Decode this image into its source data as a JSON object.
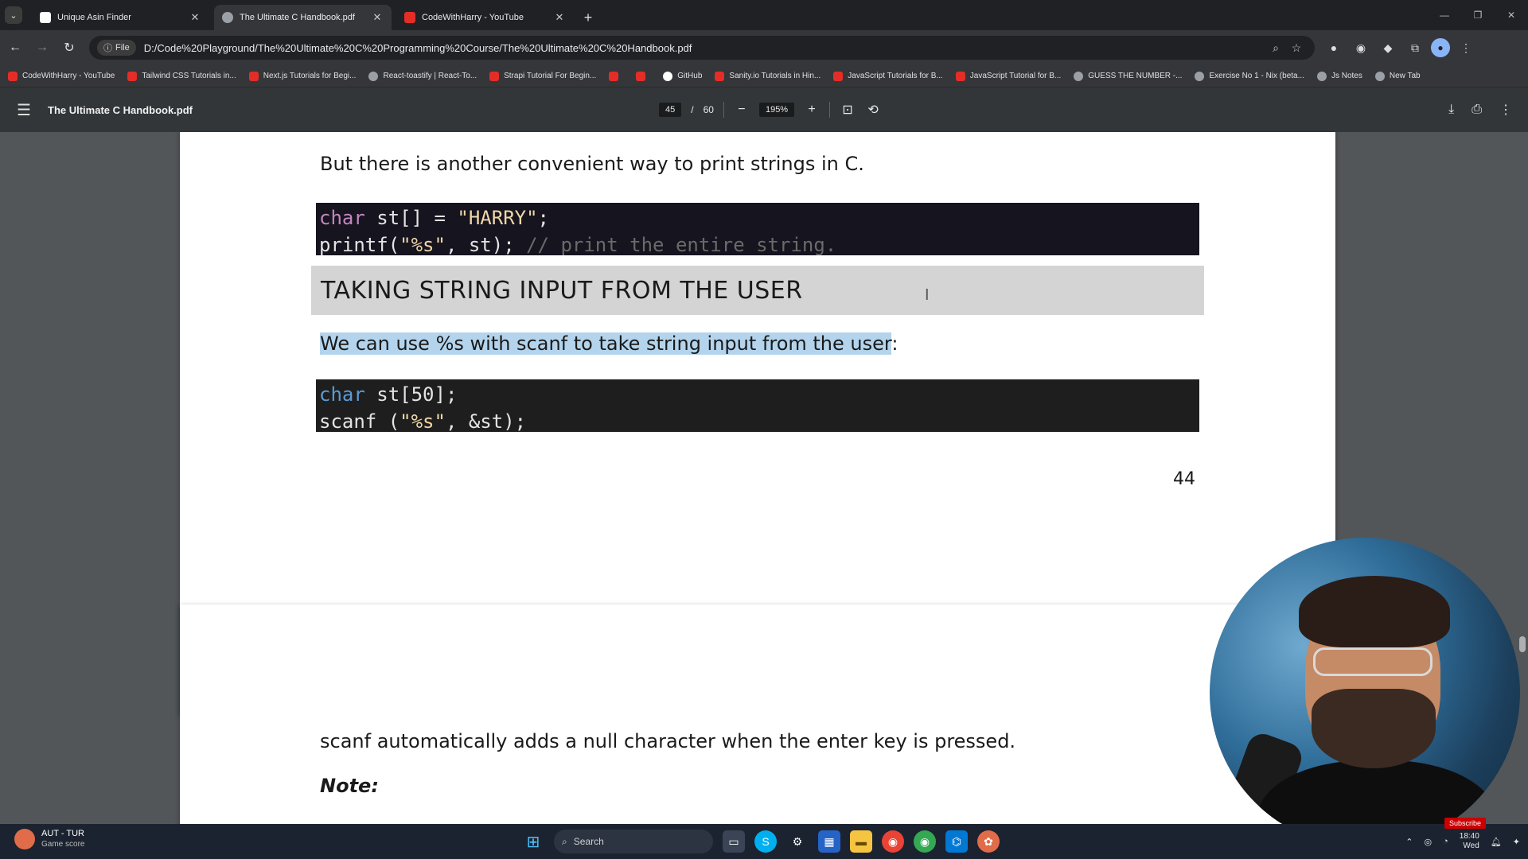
{
  "browser": {
    "tabs": [
      {
        "title": "Unique Asin Finder",
        "active": false,
        "favicon_color": "#ffffff"
      },
      {
        "title": "The Ultimate C Handbook.pdf",
        "active": true,
        "favicon_color": "#9aa0a6"
      },
      {
        "title": "CodeWithHarry - YouTube",
        "active": false,
        "favicon_color": "#e52d27"
      }
    ],
    "new_tab_label": "+",
    "address": {
      "chip_label": "File",
      "url": "D:/Code%20Playground/The%20Ultimate%20C%20Programming%20Course/The%20Ultimate%20C%20Handbook.pdf"
    },
    "bookmarks": [
      {
        "label": "CodeWithHarry - YouTube",
        "icon": "yt"
      },
      {
        "label": "Tailwind CSS Tutorials in...",
        "icon": "yt"
      },
      {
        "label": "Next.js Tutorials for Begi...",
        "icon": "yt"
      },
      {
        "label": "React-toastify | React-To...",
        "icon": "globe"
      },
      {
        "label": "Strapi Tutorial For Begin...",
        "icon": "yt"
      },
      {
        "label": "",
        "icon": "yt"
      },
      {
        "label": "",
        "icon": "yt"
      },
      {
        "label": "GitHub",
        "icon": "gh"
      },
      {
        "label": "Sanity.io Tutorials in Hin...",
        "icon": "yt"
      },
      {
        "label": "JavaScript Tutorials for B...",
        "icon": "yt"
      },
      {
        "label": "JavaScript Tutorial for B...",
        "icon": "yt"
      },
      {
        "label": "GUESS THE NUMBER -...",
        "icon": "globe"
      },
      {
        "label": "Exercise No 1 - Nix (beta...",
        "icon": "globe"
      },
      {
        "label": "Js Notes",
        "icon": "globe"
      },
      {
        "label": "New Tab",
        "icon": "globe"
      }
    ]
  },
  "pdf_viewer": {
    "doc_title": "The Ultimate C Handbook.pdf",
    "current_page": "45",
    "page_separator": "/",
    "total_pages": "60",
    "zoom": "195%",
    "zoom_out": "−",
    "zoom_in": "+"
  },
  "page44": {
    "intro": "But there is another convenient way to print strings in C.",
    "code1": {
      "line1": {
        "kw": "char",
        "rest": " st[] = ",
        "str": "\"HARRY\"",
        "end": ";"
      },
      "line2": {
        "fn": "printf(",
        "str": "\"%s\"",
        "rest": ", st); ",
        "comment": "// print the entire string."
      }
    },
    "heading": "TAKING STRING INPUT FROM THE USER",
    "para_part1": "We can use %s with scanf ",
    "para_part2": "to take string input from the user",
    "para_end": ":",
    "code2": {
      "line1": {
        "kw": "char",
        "rest": " st[50];"
      },
      "line2": {
        "fn": "scanf (",
        "str": "\"%s\"",
        "rest": ", &st);"
      }
    },
    "page_number": "44"
  },
  "page45": {
    "para": "scanf automatically adds a null character when the enter key is pressed.",
    "note": "Note:"
  },
  "taskbar": {
    "weather_title": "AUT - TUR",
    "weather_sub": "Game score",
    "search_placeholder": "Search",
    "clock_time": "18:40",
    "clock_day": "Wed",
    "subscribe": "Subscribe"
  }
}
